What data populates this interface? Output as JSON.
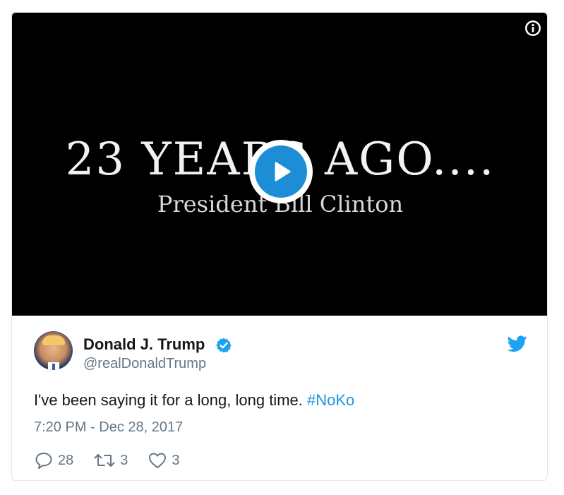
{
  "video": {
    "title": "23 YEARS AGO....",
    "subtitle": "President Bill Clinton",
    "info_icon": "info-circle-icon",
    "play_icon": "play-icon",
    "play_color": "#1d8dd6"
  },
  "tweet": {
    "author_name": "Donald J. Trump",
    "handle": "@realDonaldTrump",
    "verified_icon": "verified-badge-icon",
    "brand_icon": "twitter-bird-icon",
    "brand_color": "#1da1f2",
    "text": "I've been saying it for a long, long time.",
    "hashtag": "#NoKo",
    "timestamp": "7:20 PM - Dec 28, 2017",
    "replies": "28",
    "retweets": "3",
    "likes": "3"
  }
}
